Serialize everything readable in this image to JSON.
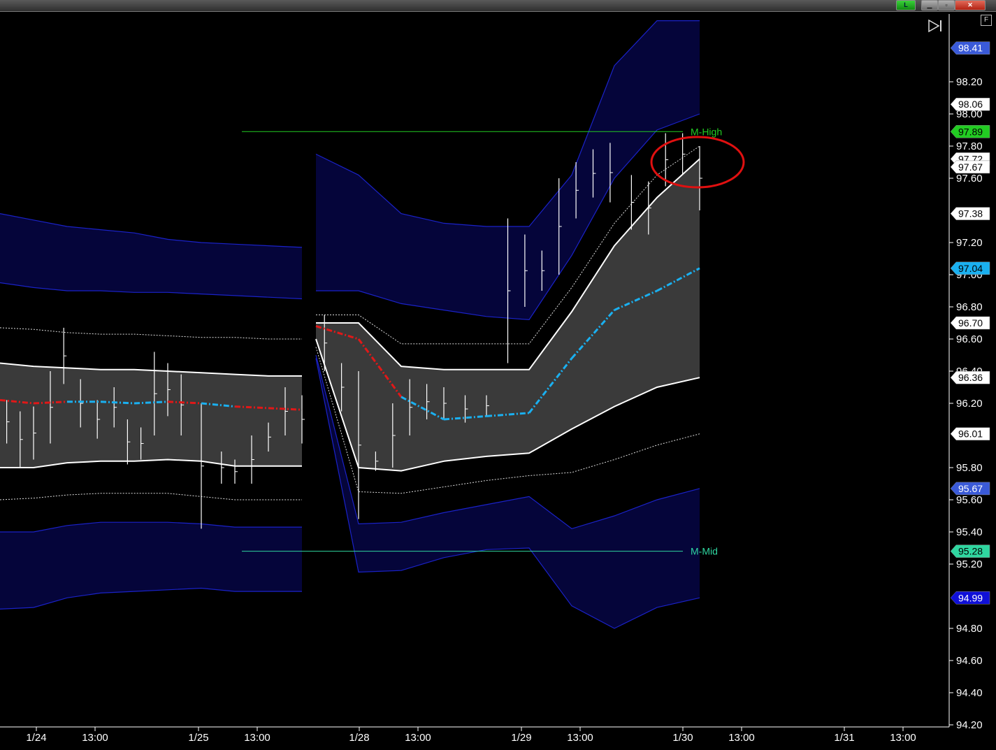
{
  "window": {
    "live_label": "L",
    "minimize_label": "▁",
    "maximize_label": "▫",
    "close_label": "✕",
    "f_label": "F"
  },
  "colors": {
    "outer_band_fill": "#05053a",
    "outer_band_line": "#1a22c8",
    "inner_band_fill": "#3a3a3a",
    "inner_band_line": "#ffffff",
    "midline_red": "#e01818",
    "midline_cyan": "#1ab0f0",
    "level_high": "#22cc22",
    "level_mid": "#2fd6a0",
    "annotation": "#e01010",
    "axis": "#ffffff"
  },
  "chart_data": {
    "type": "line",
    "ylim": [
      94.2,
      98.5
    ],
    "y_ticks": [
      "98.20",
      "98.00",
      "97.80",
      "97.60",
      "97.20",
      "97.00",
      "96.80",
      "96.60",
      "96.40",
      "96.20",
      "95.80",
      "95.60",
      "95.40",
      "95.20",
      "94.80",
      "94.60",
      "94.40",
      "94.20"
    ],
    "x_tick_labels": [
      "1/24",
      "13:00",
      "1/25",
      "13:00",
      "1/28",
      "13:00",
      "1/29",
      "13:00",
      "1/30",
      "13:00",
      "1/31",
      "13:00"
    ],
    "levels": [
      {
        "name": "M-High",
        "value": 97.89
      },
      {
        "name": "M-Mid",
        "value": 95.28
      }
    ],
    "price_tags": [
      {
        "label": "98.41",
        "value": 98.41,
        "bg": "#3a5ad8",
        "fg": "#ffffff"
      },
      {
        "label": "98.06",
        "value": 98.06,
        "bg": "#ffffff",
        "fg": "#000000"
      },
      {
        "label": "97.89",
        "value": 97.89,
        "bg": "#22cc22",
        "fg": "#000000"
      },
      {
        "label": "97.72",
        "value": 97.72,
        "bg": "#ffffff",
        "fg": "#000000"
      },
      {
        "label": "97.67",
        "value": 97.67,
        "bg": "#ffffff",
        "fg": "#000000"
      },
      {
        "label": "97.38",
        "value": 97.38,
        "bg": "#ffffff",
        "fg": "#000000"
      },
      {
        "label": "97.04",
        "value": 97.04,
        "bg": "#1ab0f0",
        "fg": "#000000"
      },
      {
        "label": "96.70",
        "value": 96.7,
        "bg": "#ffffff",
        "fg": "#000000"
      },
      {
        "label": "96.36",
        "value": 96.36,
        "bg": "#ffffff",
        "fg": "#000000"
      },
      {
        "label": "96.01",
        "value": 96.01,
        "bg": "#ffffff",
        "fg": "#000000"
      },
      {
        "label": "95.67",
        "value": 95.67,
        "bg": "#3a5ad8",
        "fg": "#ffffff"
      },
      {
        "label": "95.28",
        "value": 95.28,
        "bg": "#2fd6a0",
        "fg": "#000000"
      },
      {
        "label": "94.99",
        "value": 94.99,
        "bg": "#1010d8",
        "fg": "#ffffff"
      }
    ],
    "segments": [
      {
        "x_start": 0,
        "x_end": 9,
        "outer_upper": [
          97.38,
          97.34,
          97.3,
          97.28,
          97.26,
          97.22,
          97.2,
          97.19,
          97.18,
          97.17
        ],
        "outer_upper2": [
          96.95,
          96.92,
          96.9,
          96.9,
          96.89,
          96.89,
          96.88,
          96.87,
          96.86,
          96.85
        ],
        "dot_upper": [
          96.67,
          96.66,
          96.64,
          96.63,
          96.63,
          96.62,
          96.61,
          96.61,
          96.6,
          96.6
        ],
        "inner_upper": [
          96.45,
          96.43,
          96.42,
          96.41,
          96.41,
          96.4,
          96.39,
          96.38,
          96.37,
          96.37
        ],
        "mid": [
          96.22,
          96.2,
          96.21,
          96.21,
          96.2,
          96.21,
          96.2,
          96.18,
          96.17,
          96.16
        ],
        "inner_lower": [
          95.8,
          95.8,
          95.83,
          95.84,
          95.84,
          95.85,
          95.84,
          95.81,
          95.81,
          95.81
        ],
        "dot_lower": [
          95.6,
          95.61,
          95.63,
          95.64,
          95.64,
          95.64,
          95.62,
          95.6,
          95.6,
          95.6
        ],
        "outer_lower2": [
          95.4,
          95.4,
          95.44,
          95.46,
          95.46,
          95.46,
          95.45,
          95.43,
          95.43,
          95.43
        ],
        "outer_lower": [
          94.92,
          94.93,
          94.99,
          95.02,
          95.03,
          95.04,
          95.05,
          95.03,
          95.03,
          95.03
        ],
        "mid_colors": [
          "red",
          "red",
          "cyan",
          "cyan",
          "cyan",
          "red",
          "cyan",
          "red",
          "red",
          "red"
        ]
      },
      {
        "x_start": 10,
        "x_end": 19,
        "outer_upper": [
          97.75,
          97.62,
          97.38,
          97.32,
          97.3,
          97.3,
          97.62,
          98.3,
          98.58,
          98.58
        ],
        "outer_upper2": [
          96.9,
          96.9,
          96.82,
          96.78,
          96.74,
          96.72,
          97.12,
          97.6,
          97.9,
          98.0
        ],
        "dot_upper": [
          96.75,
          96.75,
          96.57,
          96.57,
          96.57,
          96.57,
          96.92,
          97.32,
          97.62,
          97.8
        ],
        "inner_upper": [
          96.7,
          96.7,
          96.43,
          96.41,
          96.41,
          96.41,
          96.77,
          97.18,
          97.48,
          97.72
        ],
        "mid": [
          96.68,
          96.6,
          96.24,
          96.1,
          96.12,
          96.14,
          96.48,
          96.78,
          96.9,
          97.04
        ],
        "inner_lower": [
          96.6,
          95.8,
          95.78,
          95.84,
          95.87,
          95.89,
          96.04,
          96.18,
          96.3,
          96.36
        ],
        "dot_lower": [
          96.55,
          95.65,
          95.64,
          95.68,
          95.72,
          95.75,
          95.77,
          95.85,
          95.94,
          96.01
        ],
        "outer_lower2": [
          96.5,
          95.45,
          95.46,
          95.52,
          95.57,
          95.62,
          95.42,
          95.5,
          95.6,
          95.67
        ],
        "outer_lower": [
          96.48,
          95.15,
          95.16,
          95.24,
          95.29,
          95.3,
          94.94,
          94.8,
          94.93,
          94.99
        ],
        "mid_colors": [
          "red",
          "red",
          "cyan",
          "cyan",
          "cyan",
          "cyan",
          "cyan",
          "cyan",
          "cyan",
          "cyan"
        ]
      }
    ],
    "candles": [
      {
        "x": 0.2,
        "h": 96.22,
        "l": 95.95
      },
      {
        "x": 0.6,
        "h": 96.15,
        "l": 95.8
      },
      {
        "x": 1.0,
        "h": 96.18,
        "l": 95.85
      },
      {
        "x": 1.5,
        "h": 96.4,
        "l": 95.95
      },
      {
        "x": 1.9,
        "h": 96.67,
        "l": 96.32
      },
      {
        "x": 2.4,
        "h": 96.35,
        "l": 96.05
      },
      {
        "x": 2.9,
        "h": 96.22,
        "l": 95.98
      },
      {
        "x": 3.4,
        "h": 96.3,
        "l": 96.05
      },
      {
        "x": 3.8,
        "h": 96.1,
        "l": 95.82
      },
      {
        "x": 4.2,
        "h": 96.05,
        "l": 95.85
      },
      {
        "x": 4.6,
        "h": 96.52,
        "l": 96.0
      },
      {
        "x": 5.0,
        "h": 96.45,
        "l": 96.12
      },
      {
        "x": 5.4,
        "h": 96.38,
        "l": 96.0
      },
      {
        "x": 6.0,
        "h": 96.2,
        "l": 95.42
      },
      {
        "x": 6.6,
        "h": 95.9,
        "l": 95.7
      },
      {
        "x": 7.0,
        "h": 95.85,
        "l": 95.7
      },
      {
        "x": 7.5,
        "h": 96.0,
        "l": 95.7
      },
      {
        "x": 8.0,
        "h": 96.08,
        "l": 95.9
      },
      {
        "x": 8.5,
        "h": 96.3,
        "l": 96.0
      },
      {
        "x": 9.0,
        "h": 96.25,
        "l": 95.95
      },
      {
        "x": 10.2,
        "h": 96.75,
        "l": 96.4
      },
      {
        "x": 10.6,
        "h": 96.45,
        "l": 96.15
      },
      {
        "x": 11.0,
        "h": 96.4,
        "l": 95.48
      },
      {
        "x": 11.4,
        "h": 95.9,
        "l": 95.78
      },
      {
        "x": 11.8,
        "h": 96.2,
        "l": 95.8
      },
      {
        "x": 12.2,
        "h": 96.35,
        "l": 96.0
      },
      {
        "x": 12.6,
        "h": 96.32,
        "l": 96.1
      },
      {
        "x": 13.0,
        "h": 96.3,
        "l": 96.1
      },
      {
        "x": 13.5,
        "h": 96.25,
        "l": 96.08
      },
      {
        "x": 14.0,
        "h": 96.25,
        "l": 96.12
      },
      {
        "x": 14.5,
        "h": 97.35,
        "l": 96.45
      },
      {
        "x": 14.9,
        "h": 97.25,
        "l": 96.8
      },
      {
        "x": 15.3,
        "h": 97.15,
        "l": 96.9
      },
      {
        "x": 15.7,
        "h": 97.6,
        "l": 97.0
      },
      {
        "x": 16.1,
        "h": 97.7,
        "l": 97.35
      },
      {
        "x": 16.5,
        "h": 97.78,
        "l": 97.48
      },
      {
        "x": 16.9,
        "h": 97.82,
        "l": 97.45
      },
      {
        "x": 17.4,
        "h": 97.62,
        "l": 97.28
      },
      {
        "x": 17.8,
        "h": 97.58,
        "l": 97.25
      },
      {
        "x": 18.2,
        "h": 97.88,
        "l": 97.55
      },
      {
        "x": 18.6,
        "h": 97.88,
        "l": 97.62
      },
      {
        "x": 19.0,
        "h": 97.8,
        "l": 97.4
      }
    ]
  }
}
